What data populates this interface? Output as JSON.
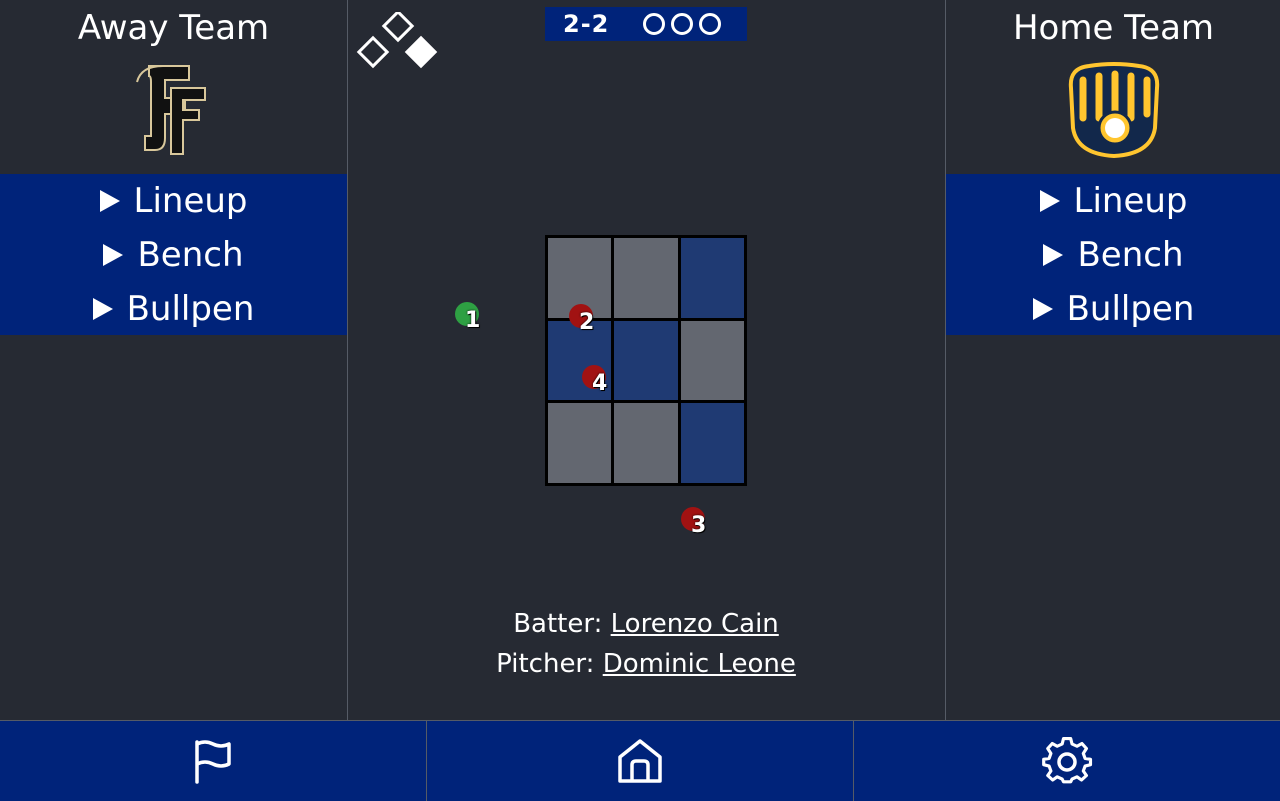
{
  "away": {
    "title": "Away Team",
    "logo_icon": "sf-giants-logo-icon",
    "menu": [
      "Lineup",
      "Bench",
      "Bullpen"
    ]
  },
  "home": {
    "title": "Home Team",
    "logo_icon": "milwaukee-brewers-logo-icon",
    "menu": [
      "Lineup",
      "Bench",
      "Bullpen"
    ]
  },
  "scoreboard": {
    "count": "2-2",
    "outs_total": 3,
    "outs_recorded": 0,
    "bases_occupied": {
      "first": true,
      "second": false,
      "third": false
    }
  },
  "strike_zone": {
    "cells": [
      "gray",
      "gray",
      "blue",
      "blue",
      "blue",
      "gray",
      "gray",
      "gray",
      "blue"
    ]
  },
  "pitches": [
    {
      "label": "1",
      "result": "ball",
      "color": "#2ea043"
    },
    {
      "label": "2",
      "result": "strike",
      "color": "#a11212"
    },
    {
      "label": "3",
      "result": "strike",
      "color": "#a11212"
    },
    {
      "label": "4",
      "result": "strike",
      "color": "#a11212"
    }
  ],
  "matchup": {
    "batter_label": "Batter: ",
    "batter_name": "Lorenzo Cain",
    "pitcher_label": "Pitcher: ",
    "pitcher_name": "Dominic Leone"
  },
  "nav": {
    "items": [
      "flag-icon",
      "home-icon",
      "gear-icon"
    ]
  },
  "colors": {
    "background": "#262a33",
    "accent_blue": "#00237a",
    "zone_gray": "#636770",
    "zone_blue": "#1f3a73"
  }
}
